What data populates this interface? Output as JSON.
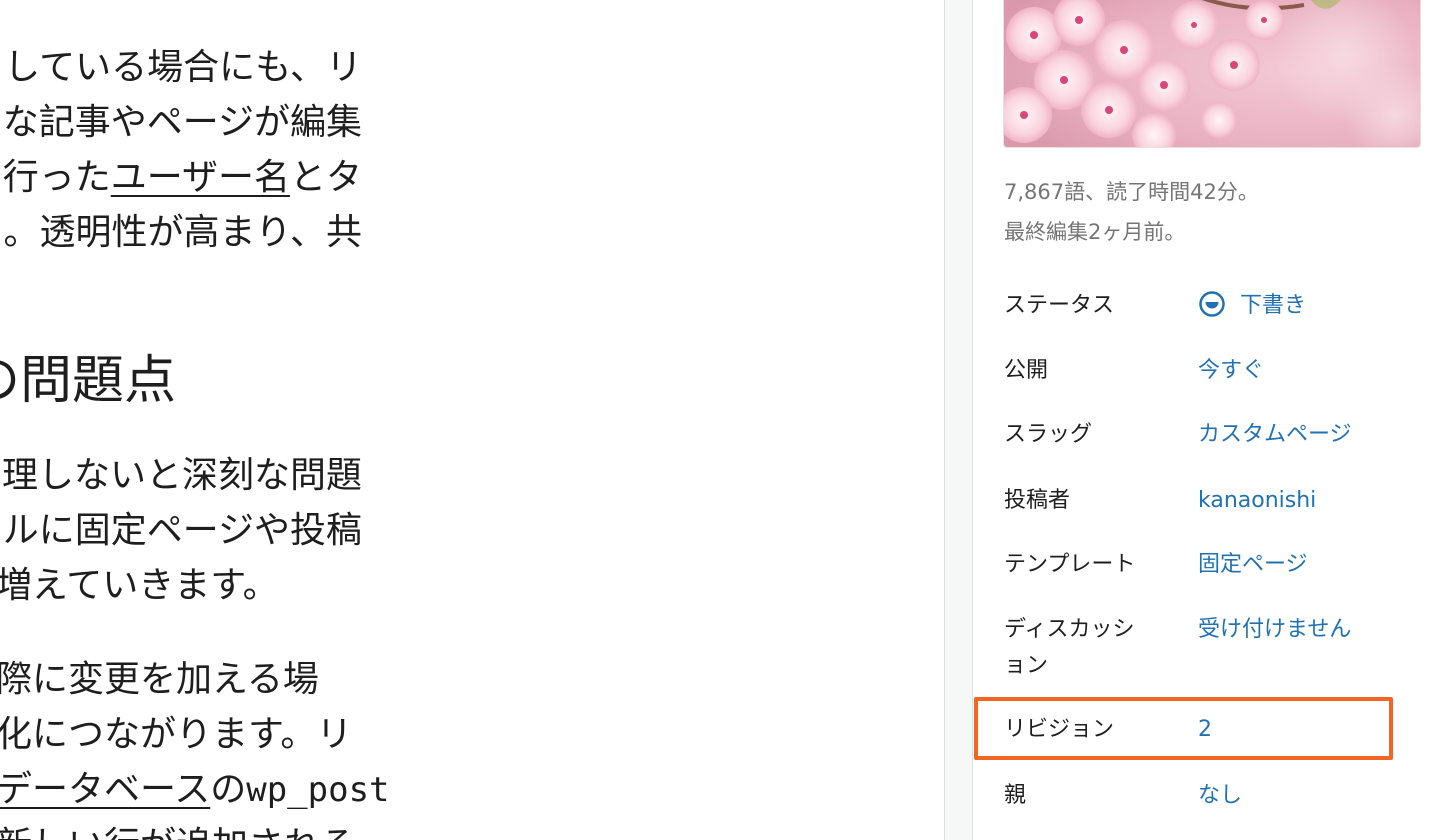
{
  "editor": {
    "paragraph1": {
      "line1": "している場合にも、リ",
      "line2": "な記事やページが編集",
      "line3_prefix": "行った",
      "line3_link": "ユーザー名",
      "line3_suffix": "とタ",
      "line4": "。透明性が高まり、共"
    },
    "heading": "の問題点",
    "paragraph2": {
      "line1": "理しないと深刻な問題",
      "line2": "ルに固定ページや投稿",
      "line3": "増えていきます。"
    },
    "paragraph3": {
      "line1": "際に変更を加える場",
      "line2": "化につながります。リ",
      "line3_link": "データベース",
      "line3_middle": "の",
      "line3_code": "wp_post",
      "line4": "新しい行が追加される"
    }
  },
  "sidebar": {
    "word_count": "7,867語、読了時間42分。",
    "last_edited": "最終編集2ヶ月前。",
    "status": {
      "label": "ステータス",
      "value": "下書き"
    },
    "publish": {
      "label": "公開",
      "value": "今すぐ"
    },
    "slug": {
      "label": "スラッグ",
      "value": "カスタムページ"
    },
    "author": {
      "label": "投稿者",
      "value": "kanaonishi"
    },
    "template": {
      "label": "テンプレート",
      "value": "固定ページ"
    },
    "discussion": {
      "label_line1": "ディスカッシ",
      "label_line2": "ョン",
      "value": "受け付けません"
    },
    "revisions": {
      "label": "リビジョン",
      "value": "2"
    },
    "parent": {
      "label": "親",
      "value": "なし"
    }
  },
  "colors": {
    "link": "#2271b1",
    "highlight": "#f26522",
    "muted_text": "#757575",
    "text": "#1e1e1e"
  }
}
